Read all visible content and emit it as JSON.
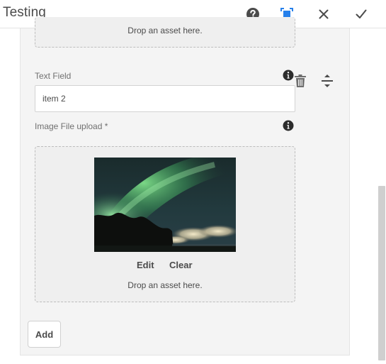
{
  "dialog": {
    "title": "Testing"
  },
  "header_icons": {
    "help": "help-circle-icon",
    "fullscreen": "fullscreen-icon",
    "close": "close-icon",
    "done": "checkmark-icon"
  },
  "top_upload": {
    "drop_text": "Drop an asset here."
  },
  "item": {
    "text_field": {
      "label": "Text Field",
      "value": "item 2",
      "placeholder": ""
    },
    "image_upload": {
      "label": "Image File upload *",
      "edit_label": "Edit",
      "clear_label": "Clear",
      "drop_text": "Drop an asset here."
    },
    "delete_icon": "trash-icon",
    "reorder_icon": "reorder-handle-icon"
  },
  "add_button": {
    "label": "Add"
  },
  "colors": {
    "panel_bg": "#f4f4f4",
    "header_accent": "#2680eb",
    "text": "#4b4b4b"
  }
}
